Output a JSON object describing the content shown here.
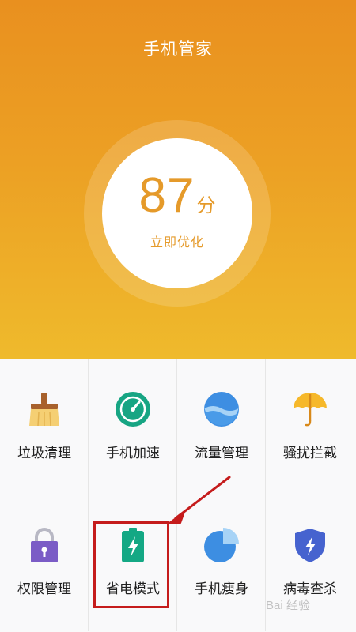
{
  "header": {
    "title": "手机管家"
  },
  "score": {
    "value": "87",
    "unit": "分",
    "action": "立即优化"
  },
  "features": [
    {
      "label": "垃圾清理",
      "icon": "broom-icon"
    },
    {
      "label": "手机加速",
      "icon": "speedometer-icon"
    },
    {
      "label": "流量管理",
      "icon": "water-globe-icon"
    },
    {
      "label": "骚扰拦截",
      "icon": "umbrella-icon"
    },
    {
      "label": "权限管理",
      "icon": "padlock-icon"
    },
    {
      "label": "省电模式",
      "icon": "battery-icon"
    },
    {
      "label": "手机瘦身",
      "icon": "pie-chart-icon"
    },
    {
      "label": "病毒查杀",
      "icon": "shield-icon"
    }
  ],
  "annotation": {
    "highlighted_item": "省电模式",
    "color": "#c51c1c"
  },
  "colors": {
    "header_top": "#e9901f",
    "header_bottom": "#efba2c",
    "score_text": "#e59a2a"
  },
  "watermark": {
    "text": "Bai 经验"
  }
}
